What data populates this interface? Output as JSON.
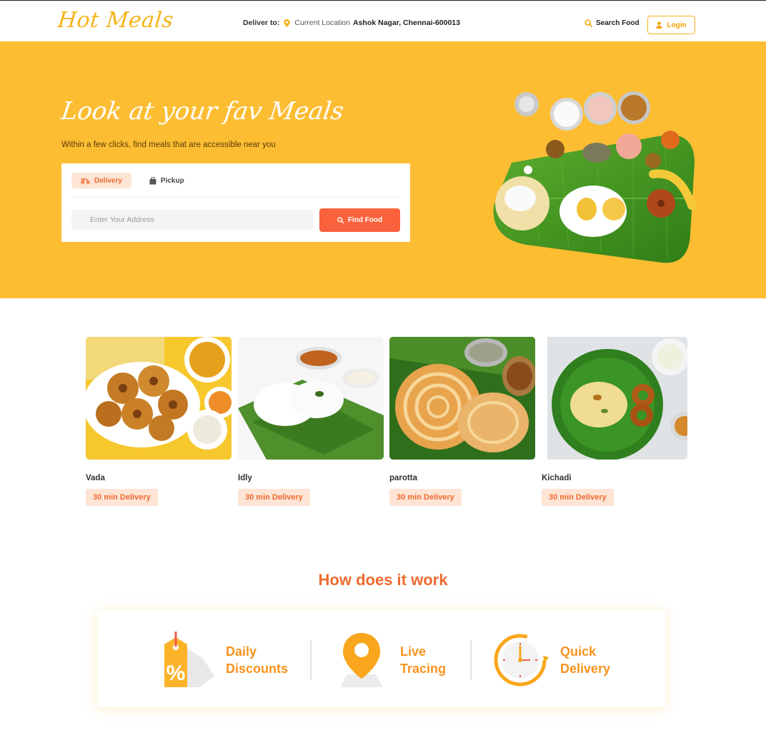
{
  "header": {
    "logo": "Hot Meals",
    "deliver_label": "Deliver to:",
    "current_location_label": "Current Location",
    "address": "Ashok Nagar, Chennai-600013",
    "search_label": "Search Food",
    "login_label": "Login"
  },
  "hero": {
    "title": "Look at your fav Meals",
    "subtitle": "Within a few clicks, find meals that are accessible near you",
    "tabs": [
      {
        "label": "Delivery",
        "active": true,
        "icon": "scooter-icon"
      },
      {
        "label": "Pickup",
        "active": false,
        "icon": "bag-icon"
      }
    ],
    "address_placeholder": "Enter Your Address",
    "find_button": "Find Food"
  },
  "foods": [
    {
      "name": "Vada",
      "badge": "30 min Delivery"
    },
    {
      "name": "Idly",
      "badge": "30 min Delivery"
    },
    {
      "name": "parotta",
      "badge": "30 min Delivery"
    },
    {
      "name": "Kichadi",
      "badge": "30 min Delivery"
    }
  ],
  "how": {
    "title": "How does it work",
    "features": [
      {
        "line1": "Daily",
        "line2": "Discounts",
        "icon": "discount-tag-icon"
      },
      {
        "line1": "Live",
        "line2": "Tracing",
        "icon": "location-pin-icon"
      },
      {
        "line1": "Quick",
        "line2": "Delivery",
        "icon": "clock-icon"
      }
    ]
  },
  "colors": {
    "brand_yellow": "#fdbd33",
    "accent_orange": "#ee6b2f",
    "button_red": "#f9623c",
    "badge_bg": "#fde4d4"
  }
}
